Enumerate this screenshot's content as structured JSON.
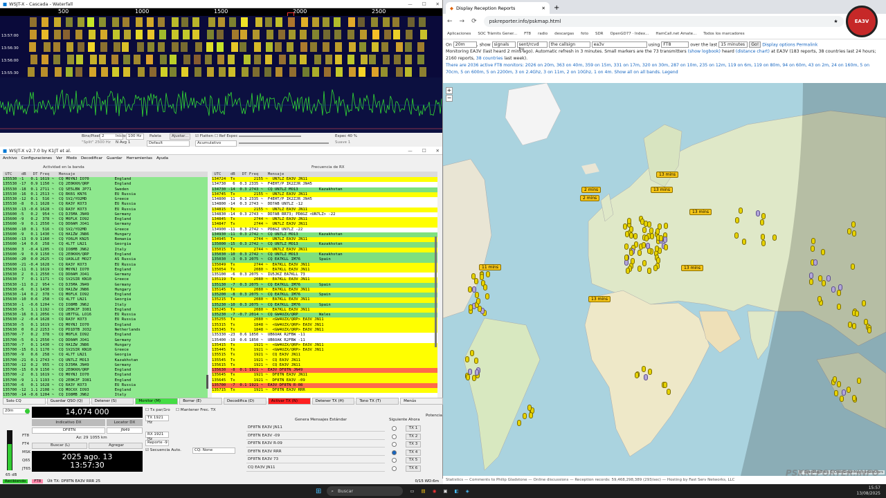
{
  "waterfall": {
    "title": "WSJT-X - Cascada - Waterfall",
    "scale": [
      "500",
      "1000",
      "1500",
      "2000",
      "2500"
    ],
    "times": [
      "13:57:00",
      "13:56:30",
      "13:56:00",
      "13:55:30",
      "13:55:00"
    ],
    "controls": {
      "bins_label": "Bins/Pixel",
      "bins_value": "2",
      "start_label": "Inicio",
      "start_value": "100 Hz",
      "palette_label": "Paleta",
      "adjust_label": "Ajustar...",
      "flatten_label": "Flatten",
      "ref_label": "Ref Espec",
      "spec_label": "Espec",
      "spec_value": "40 %",
      "split_label": "\"Split\"",
      "split_value": "2500 Hz",
      "navg_label": "N Avg",
      "navg_value": "1",
      "default_label": "Default",
      "accum_label": "Acumulativo",
      "smooth_label": "Suave",
      "smooth_value": "1"
    }
  },
  "wsjt": {
    "title": "WSJT-X   v2.7.0   by K1JT et al.",
    "menu": [
      "Archivo",
      "Configuraciones",
      "Ver",
      "Modo",
      "Decodificar",
      "Guardar",
      "Herramientas",
      "Ayuda"
    ],
    "band_title": "Actividad en la banda",
    "rx_title": "Frecuencia de RX",
    "band_header": " UTC    dB   DT Freq    Mensaje",
    "rx_header": " UTC    dB   DT Freq    Mensaje",
    "band_rows": [
      "135530 -1   0.1 1619 ~  CQ M6YNJ IO70           England",
      "135530 -17  0.9 1150 ~  CQ 2E0KKH/QRP           England",
      "135530 -18  0.1 2711 ~  CQ SE5LBN JP71          Sweden",
      "135530 -16  0.1 2513 ~  CQ RK6S KN76            EU Russia",
      "135530 -12  0.1  516 ~  CQ SV2/YO2MD            Greece",
      "135530 -8   0.1 1628 ~  CQ RA3Y KO73            EU Russia",
      "135530 -13 -0.6 1628 ~  CQ RA3Y KO73            EU Russia",
      "135600 -5   0.2  954 ~  CQ DJ5MA JN49           Germany",
      "135600 -9   0.2  378 ~  CQ M6FLK IO92           England",
      "135600 -9   0.1 2550 ~  CQ DD0AM JO41           Germany",
      "135600 -10  0.1  516 ~  CQ SV2/YO2MD            Greece",
      "135600 -9   0.1 1430 ~  CQ HA1ZW JN86           Hungary",
      "135600 -13  0.9 1160 ~  CQ YO6LM KN25           Romania",
      "135600 -14  0.6  258 ~  CQ 4L7T LN21            Georgia",
      "135600  3  -0.4 1205 ~  CQ IO8MB JN62           Italy",
      "135600 -9   0.9 1150 ~  CQ 2E0KKH/QRP           England",
      "135600 -20  0.0 2625 ~  CQ UA9LLE MO27          AS Russia",
      "135600 -21 -0.4 1628 ~  CQ RA3Y KO73            EU Russia",
      "135630 -11  0.1 1619 ~  CQ M6YNJ IO70           England",
      "135630  2   0.1 2550 ~  CQ DD0AM JO41           Germany",
      "135630  7   0.1 1171 ~  CQ SV2SIR KN10          Greece",
      "135630 -11  0.2  954 ~  CQ DJ5MA JN49           Germany",
      "135630 -6   0.1 1430 ~  CQ HA1ZW JN86           Hungary",
      "135630 -14  0.2  378 ~  CQ M6FLK IO92           England",
      "135630 -10  0.6  258 ~  CQ 4L7T LN21            Georgia",
      "135630 -1  -0.6 1204 ~  CQ IO8MB JN62           Italy",
      "135630 -5   1.1 1192 ~  CQ 2E0KJF IO81          England",
      "135630 -16  0.1 2056 ~  CQ UB7TGL LO16          EU Russia",
      "135630 -2  -0.4 1628 ~  CQ RA3Y KO73            EU Russia",
      "135630 -5   0.1 1619 ~  CQ M6YNJ IO70           England",
      "135630  0   0.2 2253 ~  CQ PD1DTB JO32          Netherlands",
      "135700 -7   0.2  378 ~  CQ M6FLK IO92           England",
      "135700 -5   0.1 2550 ~  CQ DD0AM JO41           Germany",
      "135700 -7   0.1 1430 ~  CQ HA1ZW JN86           Hungary",
      "135700 -15  0.1 1170 ~  CQ SV2SIR KN10          Greece",
      "135700 -9   0.6  258 ~  CQ 4L7T LN21            Georgia",
      "135700 -21  0.1 2743 ~  CQ UN7LZ MO13           Kazakhstan",
      "135700 -12  0.2  955 ~  CQ DJ5MA JN49           Germany",
      "135700 -15  0.9 1150 ~  CQ 2E0KKH/QRP           England",
      "135700 -2   0.1 1619 ~  CQ M6YNJ IO70           England",
      "135700 -9   1.1 1193 ~  CQ 2E0KJF IO81          England",
      "135700 -6   0.1 1628 ~  CQ RA3Y KO73            EU Russia",
      "135700 -12  1.1 2108 ~  CQ MOCXX IO93           England",
      "135700 -14 -0.6 1204 ~  CQ IO8MB JN62           Italy"
    ],
    "rx_rows": [
      {
        "t": "134724  Tx        2155 ~  UN7LZ EA3V JN11",
        "c": "#ffff00"
      },
      {
        "t": "134730   6  0.3 2335 ~  F4EHT/P IK2ZJR JN45",
        "c": "#ffffff"
      },
      {
        "t": "134730 -14  0.3 2743 ~  CQ UN7LZ MO13         Kazakhstan",
        "c": "#7ee07e"
      },
      {
        "t": "134745  Tx        2155 ~  UN7LZ EA3V JN11",
        "c": "#ffff00"
      },
      {
        "t": "134800  11  0.3 2335 ~  F4EHT/P IK2ZJR JN45",
        "c": "#ffffff"
      },
      {
        "t": "134800 -14  0.3 2743 ~  DD7AB UN7LZ -12",
        "c": "#ffffff"
      },
      {
        "t": "134815  Tx        2155 ~  UN7LZ EA3V JN11",
        "c": "#ffff00"
      },
      {
        "t": "134830 -14  0.3 2743 ~  DD7AB RR73; PD8GZ <UN7LZ> -22",
        "c": "#ffffff"
      },
      {
        "t": "134845  Tx        2744 ~  UN7LZ EA3V JN11",
        "c": "#ffff00"
      },
      {
        "t": "134847  Tx        2744 ~  UN7LZ EA3V JN11",
        "c": "#ffff00"
      },
      {
        "t": "134900 -11  0.3 2742 ~  PD8GZ UN7LZ -22",
        "c": "#ffffff"
      },
      {
        "t": "134930 -11  0.3 2742 ~  CQ UN7LZ MO13         Kazakhstan",
        "c": "#7ee07e"
      },
      {
        "t": "134945  Tx        2744 ~  UN7LZ EA3V JN11",
        "c": "#ffff00"
      },
      {
        "t": "135000 -15  0.3 2742 ~  CQ UN7LZ MO13         Kazakhstan",
        "c": "#7ee07e"
      },
      {
        "t": "135015  Tx        2744 ~  UN7LZ EA3V JN11",
        "c": "#ffff00"
      },
      {
        "t": "135030 -10  0.3 2742 ~  CQ UN7LZ MO13         Kazakhstan",
        "c": "#7ee07e"
      },
      {
        "t": "135030  -3  0.3 2075 ~  CQ EA7KLL IM76        Spain",
        "c": "#7ee07e"
      },
      {
        "t": "135049  Tx        2744 ~  EA7KLL EA3V JN11",
        "c": "#ffff00"
      },
      {
        "t": "135054  Tx        2080 ~  EA7KLL EA3V JN11",
        "c": "#ffff00"
      },
      {
        "t": "135100  -6  0.3 2075 ~  IU5JKZ EA7KLL 73",
        "c": "#ffffff"
      },
      {
        "t": "135119  Tx        2080 ~  EA7KLL EA3V JN11",
        "c": "#ffff00"
      },
      {
        "t": "135130  -7  0.3 2075 ~  CQ EA7KLL IM76        Spain",
        "c": "#7ee07e"
      },
      {
        "t": "135145  Tx        2080 ~  EA7KLL EA3V JN11",
        "c": "#ffff00"
      },
      {
        "t": "135200  -8  0.3 2075 ~  CQ EA7KLL IM76        Spain",
        "c": "#7ee07e"
      },
      {
        "t": "135215  Tx        2080 ~  EA7KLL EA3V JN11",
        "c": "#ffff00"
      },
      {
        "t": "135230 -10  0.3 2075 ~  CQ EA7KLL IM76        Spain",
        "c": "#7ee07e"
      },
      {
        "t": "135245  Tx        2080 ~  EA7KLL EA3V JN11",
        "c": "#ffff00"
      },
      {
        "t": "135230  -7 -0.7 2014 ~  CQ GW4UZX/QRP         Wales",
        "c": "#7ee07e"
      },
      {
        "t": "135255  Tx        2080 ~  <GW4UZX/QRP> EA3V JN11",
        "c": "#ffff00"
      },
      {
        "t": "135315  Tx        1848 ~  <GW4UZX/QRP> EA3V JN11",
        "c": "#ffff00"
      },
      {
        "t": "135345  Tx        1848 ~  <GW4UZX/QRP> EA3V JN11",
        "c": "#ffff00"
      },
      {
        "t": "135330 -23  0.6 1850 ~  UB6OAK R2FBW -11",
        "c": "#ffffff"
      },
      {
        "t": "135400 -19  0.6 1850 ~  UB6OAK R2FBW -11",
        "c": "#ffffff"
      },
      {
        "t": "135415  Tx        1921 ~  <GW4UZX/QRP> EA3V JN11",
        "c": "#ffff00"
      },
      {
        "t": "135445  Tx        1921 ~  <GW4UZX/QRP> EA3V JN11",
        "c": "#ffff00"
      },
      {
        "t": "135515  Tx        1921 ~  CQ EA3V JN11",
        "c": "#ffff00"
      },
      {
        "t": "135545  Tx        1921 ~  CQ EA3V JN11",
        "c": "#ffff00"
      },
      {
        "t": "135615  Tx        1921 ~  CQ EA3V JN11",
        "c": "#ffff00"
      },
      {
        "t": "135630  -8  0.1 1921 ~  EA3V DF8TN JN49",
        "c": "#ff6a4a"
      },
      {
        "t": "135645  Tx        1921 ~  DF8TN EA3V JN11",
        "c": "#ffff00"
      },
      {
        "t": "135645  Tx        1921 ~  DF8TN EA3V -09",
        "c": "#ffff00"
      },
      {
        "t": "135700  -7  0.1 1921 ~  EA3V DF8TN R-08",
        "c": "#ff6a4a"
      },
      {
        "t": "135715  Tx        1921 ~  DF8TN EA3V RRR",
        "c": "#ffff00"
      }
    ],
    "buttons": [
      {
        "label": "Solo CQ",
        "bg": "#f0f0f0"
      },
      {
        "label": "Guardar QSO (Q)",
        "bg": "#e8e8e8"
      },
      {
        "label": "Detener (S)",
        "bg": "#e8e8e8"
      },
      {
        "label": "Monitor (M)",
        "bg": "#44dd44"
      },
      {
        "label": "Borrar (E)",
        "bg": "#e8e8e8"
      },
      {
        "label": "Decodifica (D)",
        "bg": "#e8e8e8"
      },
      {
        "label": "Activar TX (N)",
        "bg": "#ff2020"
      },
      {
        "label": "Detener TX (H)",
        "bg": "#e8e8e8"
      },
      {
        "label": "Tono TX (T)",
        "bg": "#e8e8e8"
      },
      {
        "label": "Menús",
        "bg": "#f0f0f0"
      }
    ],
    "band": "20m",
    "frequency": "14,074 000",
    "dx_call_label": "Indicativo DX",
    "dx_grid_label": "Locator DX",
    "dx_call": "DF8TN",
    "dx_grid": "JN49",
    "az": "Az: 29",
    "dist": "1055 km",
    "lookup_label": "Buscar (L)",
    "add_label": "Agregar",
    "date": "2025 ago. 13",
    "time": "13:57:30",
    "tx_even": "Tx par/1ro",
    "hold_tx": "Mantener Frec. TX",
    "tx_freq": "TX  1921  Hz",
    "rx_freq": "RX  1921  Hz",
    "report": "Reporte -9",
    "auto_seq": "Secuencia Auto.",
    "cq_none": "CQ: None",
    "msg_header": "Genera Mensajes Estándar",
    "next_label": "Siguiente",
    "now_label": "Ahora",
    "power_label": "Potencia",
    "messages": [
      {
        "text": "DF8TN EA3V JN11",
        "btn": "TX 1"
      },
      {
        "text": "DF8TN EA3V -09",
        "btn": "TX 2"
      },
      {
        "text": "DF8TN EA3V R-09",
        "btn": "TX 3"
      },
      {
        "text": "DF8TN EA3V RRR",
        "btn": "TX 4"
      },
      {
        "text": "DF8TN EA3V 73",
        "btn": "TX 5"
      },
      {
        "text": "CQ EA3V JN11",
        "btn": "TX 6"
      }
    ],
    "modes": [
      "FT8",
      "FT4",
      "MSK",
      "Q65",
      "JT65"
    ],
    "level": "65 dB",
    "status": [
      "Recibiendo",
      "FT8",
      "Últ TX: DF8TN EA3V RRR 25"
    ],
    "status_right": "0/15   WD:6m"
  },
  "browser": {
    "tab_title": "Display Reception Reports",
    "url": "pskreporter.info/pskmap.html",
    "bookmarks": [
      "Aplicaciones",
      "SOC Tràmits Gener...",
      "FT8",
      "radio",
      "descargas",
      "foto",
      "SDR",
      "OpenGD77 · Index...",
      "HamCall.net Amate...",
      "Todos los marcadores"
    ],
    "form": {
      "on": "On",
      "band": "20m",
      "show": "show",
      "signals": "signals",
      "sentrcvd": "sent/rcvd by",
      "callsign_label": "the callsign",
      "call": "ea3v",
      "using": "using",
      "mode": "FT8",
      "over": "over the last",
      "period": "15 minutes",
      "go": "Go!",
      "display_options": "Display options",
      "permalink": "Permalink"
    },
    "line2": "Monitoring EA3V (last heard 2 mins ago). Automatic refresh in 3 minutes. Small markers are the 73 transmitters",
    "line2_link": "(show logbook)",
    "line2b": "heard",
    "line2_link2": "(distance chart)",
    "line2c": "at EA3V (183 reports, 38 countries last 24 hours; 2160 reports,",
    "line2_link3": "38 countries",
    "line2d": "last week).",
    "monitors": "There are 2036 active FT8 monitors: 2026 on 20m, 363 on 40m, 359 on 15m, 331 on 17m, 320 on 30m, 287 on 10m, 235 on 12m, 119 on 6m, 119 on 80m, 94 on 60m, 43 on 2m, 24 on 160m, 5 on 70cm, 5 on 600m, 5 on 2200m, 3 on 2.4Ghz, 3 on 11m, 2 on 10Ghz, 1 on 4m.",
    "show_all": "Show all on all bands.",
    "legend": "Legend",
    "bubbles": [
      "13 mins",
      "2 mins",
      "2 mins",
      "13 mins",
      "11 mins",
      "13 mins",
      "13 mins",
      "13 mins"
    ],
    "attribution": "© OpenMapTiles © OpenStreetMap contributors",
    "footer": "Statistics — Comments to Philip Gladstone — Online discussions — Reception records: 59,468,298,389 (293/sec) — Hosting by Fast Serv Networks, LLC",
    "watermark": "PSKREPORTER.INFO",
    "logo_text": "EA3V"
  },
  "taskbar": {
    "search": "Buscar",
    "time": "15:57",
    "date": "13/08/2025"
  }
}
